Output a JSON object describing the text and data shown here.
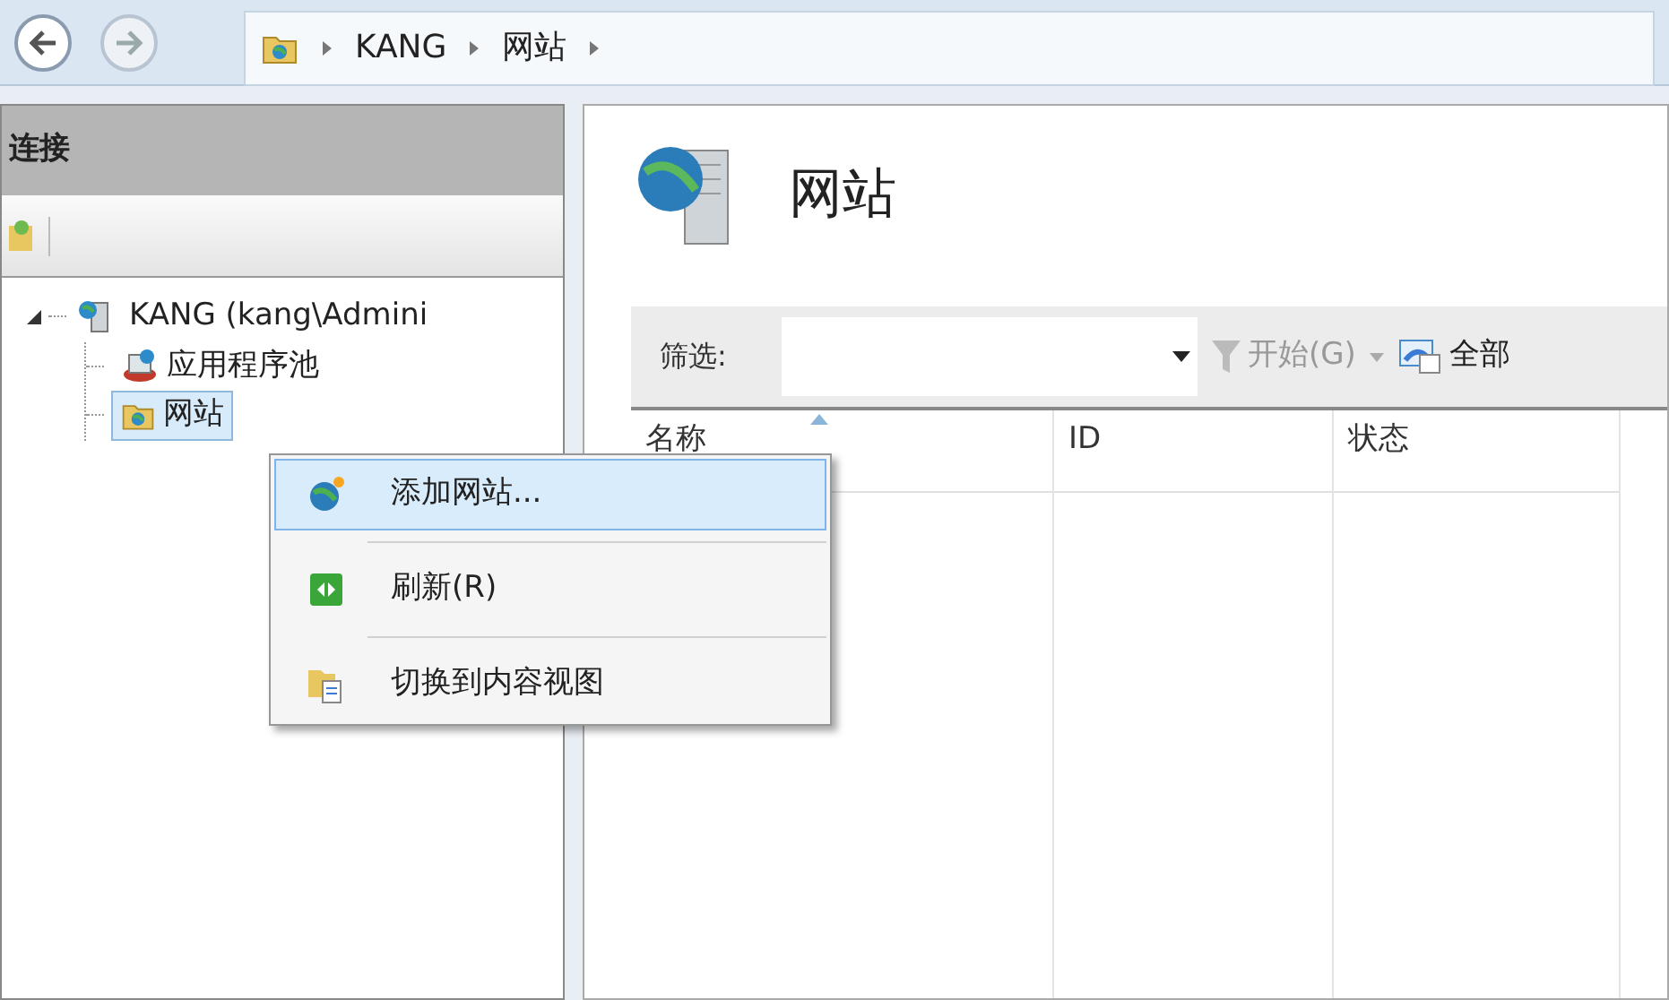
{
  "nav": {
    "breadcrumb": [
      "KANG",
      "网站"
    ]
  },
  "connections": {
    "title": "连接",
    "tree": [
      {
        "label": "KANG (kang\\Admini",
        "expanded": true,
        "selected": false,
        "children": [
          {
            "label": "应用程序池",
            "selected": false
          },
          {
            "label": "网站",
            "selected": true
          }
        ]
      }
    ]
  },
  "content": {
    "title": "网站",
    "filter": {
      "label": "筛选:",
      "start": {
        "label": "开始(G)",
        "disabled": true
      },
      "show_all": {
        "label": "全部"
      }
    },
    "table": {
      "columns": [
        {
          "label": "名称",
          "sorted": true
        },
        {
          "label": "ID",
          "sorted": false
        },
        {
          "label": "状态",
          "sorted": false
        }
      ]
    }
  },
  "context_menu": [
    {
      "label": "添加网站...",
      "selected": true
    },
    {
      "label": "刷新(R)",
      "selected": false
    },
    {
      "label": "切换到内容视图",
      "selected": false
    }
  ]
}
